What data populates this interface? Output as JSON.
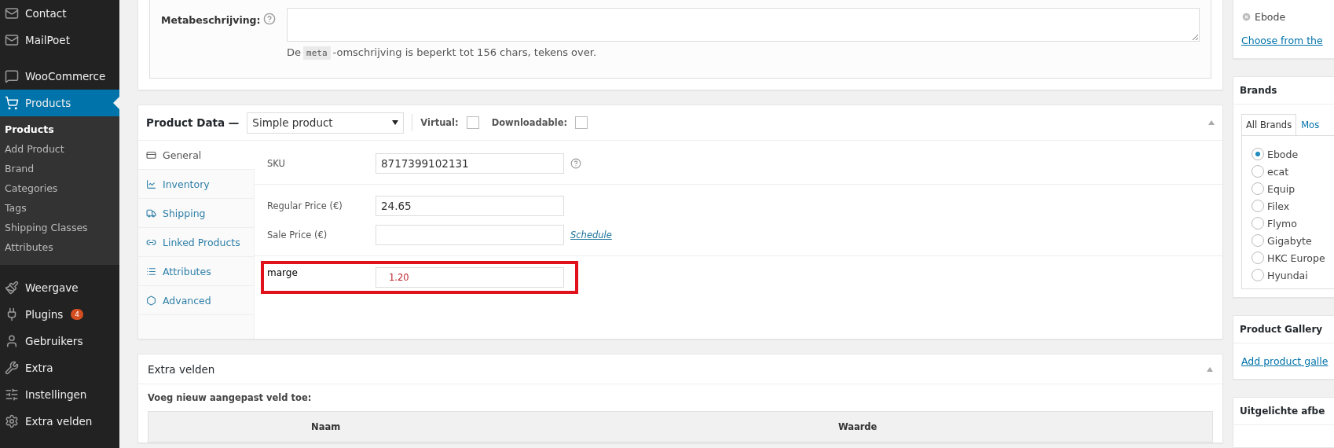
{
  "sidebar": {
    "items": [
      {
        "label": "Contact",
        "selected": false
      },
      {
        "label": "MailPoet",
        "selected": false
      },
      {
        "label": "WooCommerce",
        "selected": false
      },
      {
        "label": "Products",
        "selected": true,
        "children": [
          {
            "label": "Products",
            "selected": true
          },
          {
            "label": "Add Product",
            "selected": false
          },
          {
            "label": "Brand",
            "selected": false
          },
          {
            "label": "Categories",
            "selected": false
          },
          {
            "label": "Tags",
            "selected": false
          },
          {
            "label": "Shipping Classes",
            "selected": false
          },
          {
            "label": "Attributes",
            "selected": false
          }
        ]
      },
      {
        "label": "Weergave",
        "selected": false
      },
      {
        "label": "Plugins",
        "selected": false,
        "badge": "4"
      },
      {
        "label": "Gebruikers",
        "selected": false
      },
      {
        "label": "Extra",
        "selected": false
      },
      {
        "label": "Instellingen",
        "selected": false
      },
      {
        "label": "Extra velden",
        "selected": false
      }
    ]
  },
  "meta": {
    "label": "Metabeschrijving:",
    "hint_before": "De",
    "hint_code": "meta",
    "hint_after": "-omschrijving is beperkt tot 156 chars, tekens over."
  },
  "product_data": {
    "title": "Product Data —",
    "type": "Simple product",
    "options": [
      {
        "label": "Virtual:",
        "checked": false
      },
      {
        "label": "Downloadable:",
        "checked": false
      }
    ],
    "tabs": [
      {
        "label": "General",
        "selected": true
      },
      {
        "label": "Inventory",
        "selected": false
      },
      {
        "label": "Shipping",
        "selected": false
      },
      {
        "label": "Linked Products",
        "selected": false
      },
      {
        "label": "Attributes",
        "selected": false
      },
      {
        "label": "Advanced",
        "selected": false
      }
    ],
    "groups": [
      [
        {
          "label": "SKU",
          "value": "8717399102131",
          "help": true,
          "highlighted": false
        }
      ],
      [
        {
          "label": "Regular Price (€)",
          "value": "24.65",
          "help": false,
          "highlighted": false
        },
        {
          "label": "Sale Price (€)",
          "link": "Schedule",
          "help": false,
          "highlighted": false
        }
      ],
      [
        {
          "label": "marge",
          "value": "1.20",
          "help": false,
          "highlighted": true
        }
      ]
    ]
  },
  "extra_velden": {
    "title": "Extra velden",
    "subtitle": "Voeg nieuw aangepast veld toe:",
    "columns": [
      "Naam",
      "Waarde"
    ]
  },
  "right": {
    "tag": "Ebode",
    "tag_link": "Choose from the",
    "brands": {
      "title": "Brands",
      "tabs": [
        {
          "label": "All Brands",
          "selected": true
        },
        {
          "label": "Mos",
          "selected": false
        }
      ],
      "options": [
        {
          "label": "Ebode",
          "selected": true
        },
        {
          "label": "ecat",
          "selected": false
        },
        {
          "label": "Equip",
          "selected": false
        },
        {
          "label": "Filex",
          "selected": false
        },
        {
          "label": "Flymo",
          "selected": false
        },
        {
          "label": "Gigabyte",
          "selected": false
        },
        {
          "label": "HKC Europe",
          "selected": false
        },
        {
          "label": "Hyundai",
          "selected": false
        }
      ]
    },
    "gallery": {
      "title": "Product Gallery",
      "link": "Add product galle"
    },
    "featured": {
      "title": "Uitgelichte afbe"
    }
  }
}
